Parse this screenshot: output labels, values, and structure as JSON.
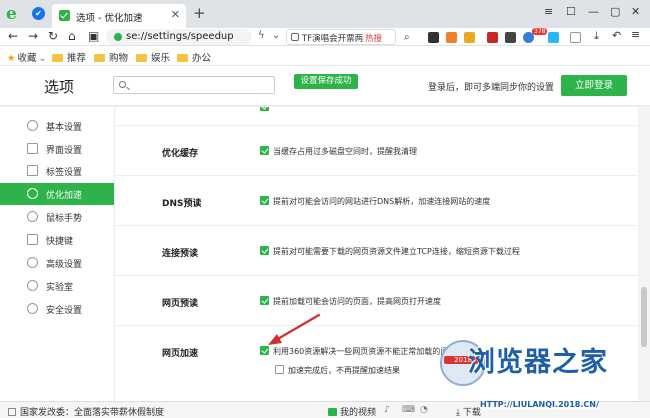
{
  "browser": {
    "tab_title": "选项 - 优化加速",
    "url": "se://settings/speedup",
    "search_text": "TF演唱会开票两年",
    "search_hot": "热搜",
    "toolbar_badge": "378"
  },
  "bookmarks": [
    {
      "label": "收藏",
      "kind": "star"
    },
    {
      "label": "推荐",
      "kind": "folder"
    },
    {
      "label": "购物",
      "kind": "folder"
    },
    {
      "label": "娱乐",
      "kind": "folder"
    },
    {
      "label": "办公",
      "kind": "folder"
    }
  ],
  "header": {
    "title": "选项",
    "toast": "设置保存成功",
    "login_tip": "登录后，即可多端同步你的设置",
    "login_button": "立即登录"
  },
  "sidebar": {
    "items": [
      {
        "label": "基本设置",
        "icon": "settings-icon",
        "active": false
      },
      {
        "label": "界面设置",
        "icon": "layout-icon",
        "active": false
      },
      {
        "label": "标签设置",
        "icon": "tag-icon",
        "active": false
      },
      {
        "label": "优化加速",
        "icon": "lightning-icon",
        "active": true
      },
      {
        "label": "鼠标手势",
        "icon": "mouse-icon",
        "active": false
      },
      {
        "label": "快捷键",
        "icon": "keyboard-icon",
        "active": false
      },
      {
        "label": "高级设置",
        "icon": "gear-icon",
        "active": false
      },
      {
        "label": "实验室",
        "icon": "flask-icon",
        "active": false
      },
      {
        "label": "安全设置",
        "icon": "shield-icon",
        "active": false
      }
    ]
  },
  "sections": [
    {
      "label": "优化缓存",
      "options": [
        {
          "text": "当缓存占用过多磁盘空间时，提醒我清理",
          "checked": true
        }
      ]
    },
    {
      "label": "DNS预读",
      "options": [
        {
          "text": "提前对可能会访问的网站进行DNS解析，加速连接网站的速度",
          "checked": true
        }
      ]
    },
    {
      "label": "连接预读",
      "options": [
        {
          "text": "提前对可能需要下载的网页资源文件建立TCP连接，缩短资源下载过程",
          "checked": true
        }
      ]
    },
    {
      "label": "网页预读",
      "options": [
        {
          "text": "提前加载可能会访问的页面，提高网页打开速度",
          "checked": true
        }
      ]
    },
    {
      "label": "网页加速",
      "options": [
        {
          "text": "利用360资源解决一些网页资源不能正常加载的问题",
          "checked": true
        },
        {
          "text": "加速完成后，不再提醒加速结果",
          "checked": false
        }
      ]
    }
  ],
  "statusbar": {
    "news": "国家发改委：全面落实带薪休假制度",
    "video": "我的视频",
    "download": "下载"
  },
  "watermark": {
    "year": "2018",
    "name": "浏览器之家",
    "url": "HTTP://LIULANQI.2018.CN/"
  },
  "colors": {
    "accent": "#2db34a",
    "arrow": "#d32f2f"
  }
}
